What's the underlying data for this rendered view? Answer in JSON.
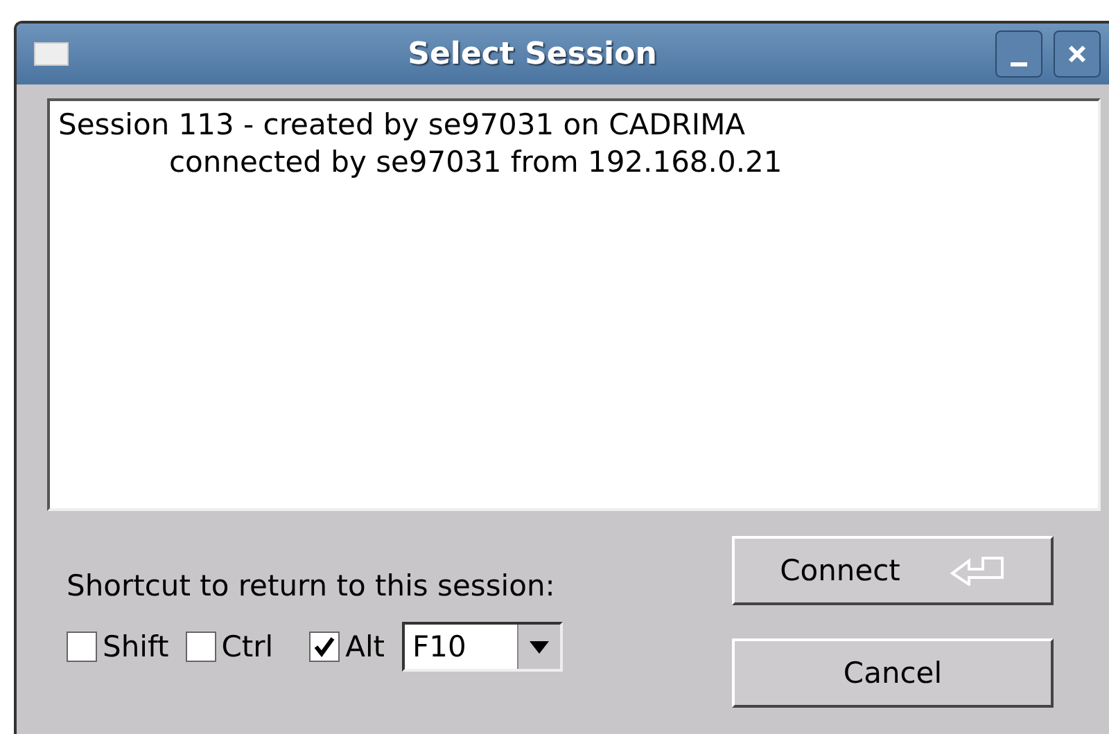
{
  "window": {
    "title": "Select Session"
  },
  "sessions": [
    {
      "lines": [
        "Session 113 - created by se97031 on CADRIMA",
        "connected by se97031 from 192.168.0.21"
      ]
    }
  ],
  "shortcut": {
    "label": "Shortcut to return to this session:",
    "modifiers": [
      {
        "label": "Shift",
        "checked": false
      },
      {
        "label": "Ctrl",
        "checked": false
      },
      {
        "label": "Alt",
        "checked": true
      }
    ],
    "key": "F10"
  },
  "buttons": [
    {
      "label": "Connect",
      "kind": "default"
    },
    {
      "label": "Cancel",
      "kind": "normal"
    }
  ]
}
